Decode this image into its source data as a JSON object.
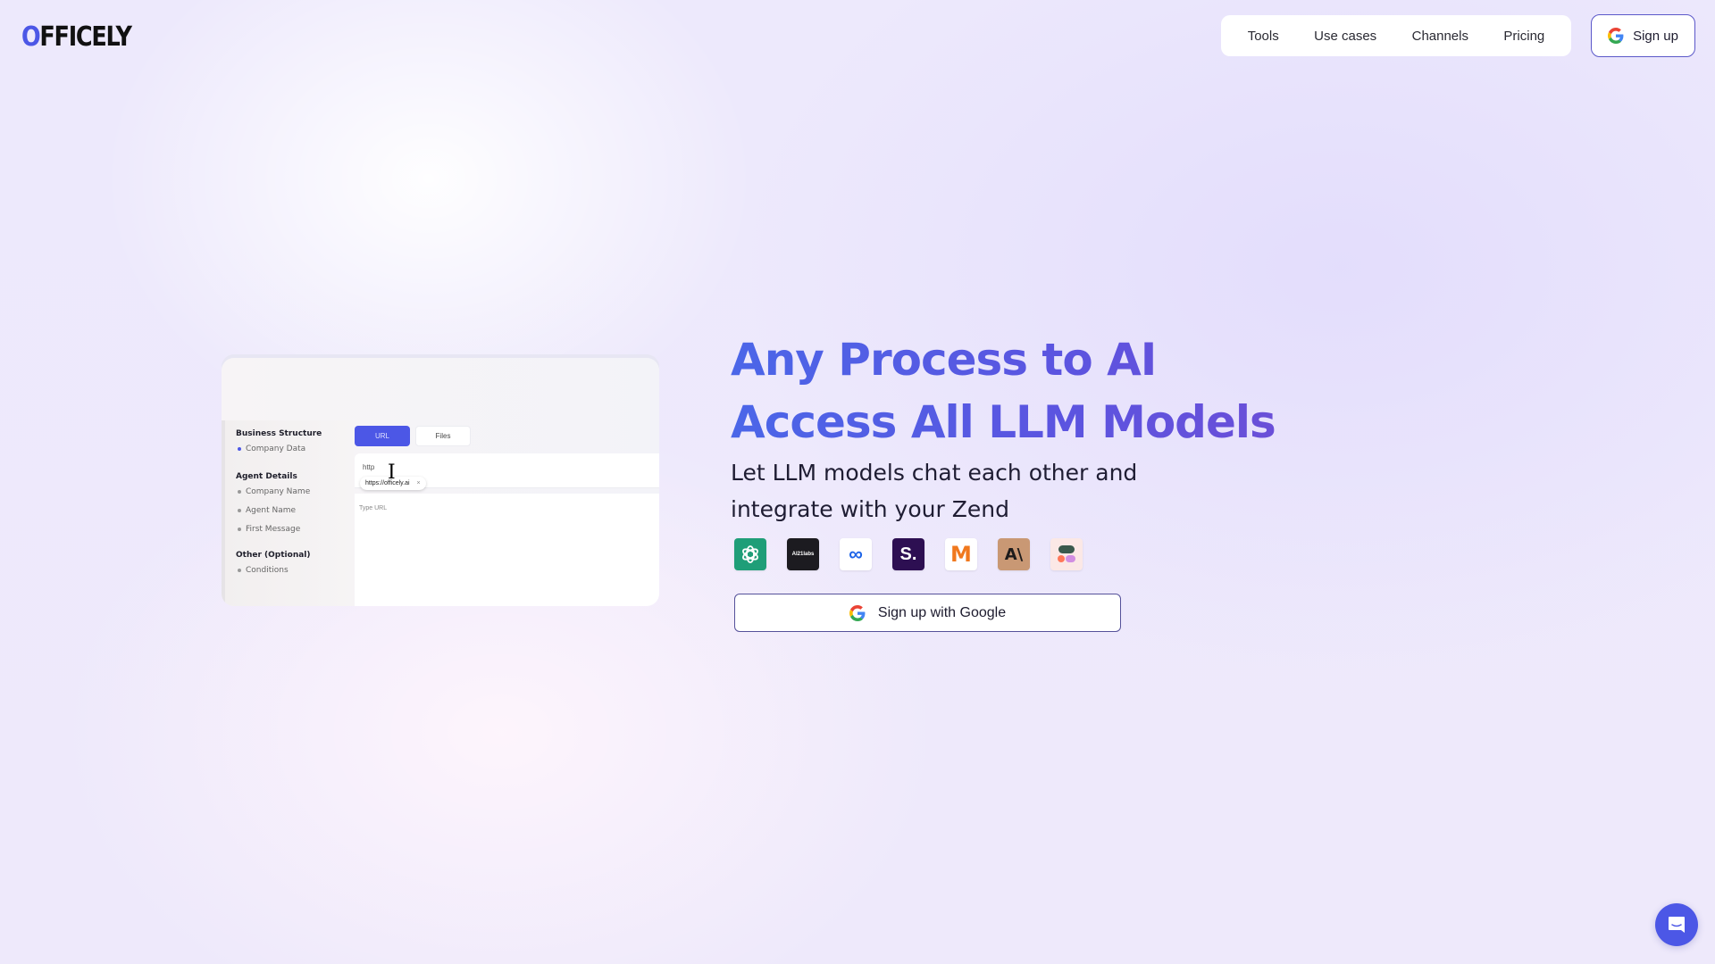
{
  "brand": {
    "logo_first": "O",
    "logo_rest": "FFICELY",
    "accent": "#4c57e6"
  },
  "nav": {
    "items": [
      {
        "label": "Tools"
      },
      {
        "label": "Use cases"
      },
      {
        "label": "Channels"
      },
      {
        "label": "Pricing"
      }
    ],
    "signup_label": "Sign up",
    "signup_icon": "google-icon"
  },
  "preview": {
    "sections": [
      {
        "title": "Business Structure",
        "items": [
          "Company Data"
        ]
      },
      {
        "title": "Agent Details",
        "items": [
          "Company Name",
          "Agent Name",
          "First Message"
        ]
      },
      {
        "title": "Other (Optional)",
        "items": [
          "Conditions"
        ]
      }
    ],
    "tabs": {
      "url": "URL",
      "files": "Files"
    },
    "url_input_value": "http",
    "url_chip": "https://officely.ai",
    "url_chip_close": "×",
    "content_placeholder": "Type URL"
  },
  "hero": {
    "title_line1": "Any Process to AI",
    "title_line2": "Access All LLM Models",
    "subtitle_line1": "Let LLM models chat each other and",
    "subtitle_line2": "integrate with your Zend",
    "llm_logos": [
      {
        "name": "openai-icon",
        "label": "",
        "bg": "#1f9e78",
        "fg": "#ffffff"
      },
      {
        "name": "ai21-labs-icon",
        "label": "AI21labs",
        "bg": "#1c1b20",
        "fg": "#ffffff"
      },
      {
        "name": "meta-icon",
        "label": "∞",
        "bg": "#ffffff",
        "fg": "#1d64e8"
      },
      {
        "name": "stability-icon",
        "label": "S.",
        "bg": "#2d0f52",
        "fg": "#ffffff"
      },
      {
        "name": "mistral-icon",
        "label": "M",
        "bg": "#ffffff",
        "fg": "#f0781e"
      },
      {
        "name": "anthropic-icon",
        "label": "A\\",
        "bg": "#c99874",
        "fg": "#1d1b1b"
      },
      {
        "name": "cohere-icon",
        "label": "",
        "bg": "#fbe8e6",
        "fg": "#39594d"
      }
    ],
    "cta_label": "Sign up with Google"
  },
  "chat_launcher": {
    "icon": "chat-icon"
  }
}
